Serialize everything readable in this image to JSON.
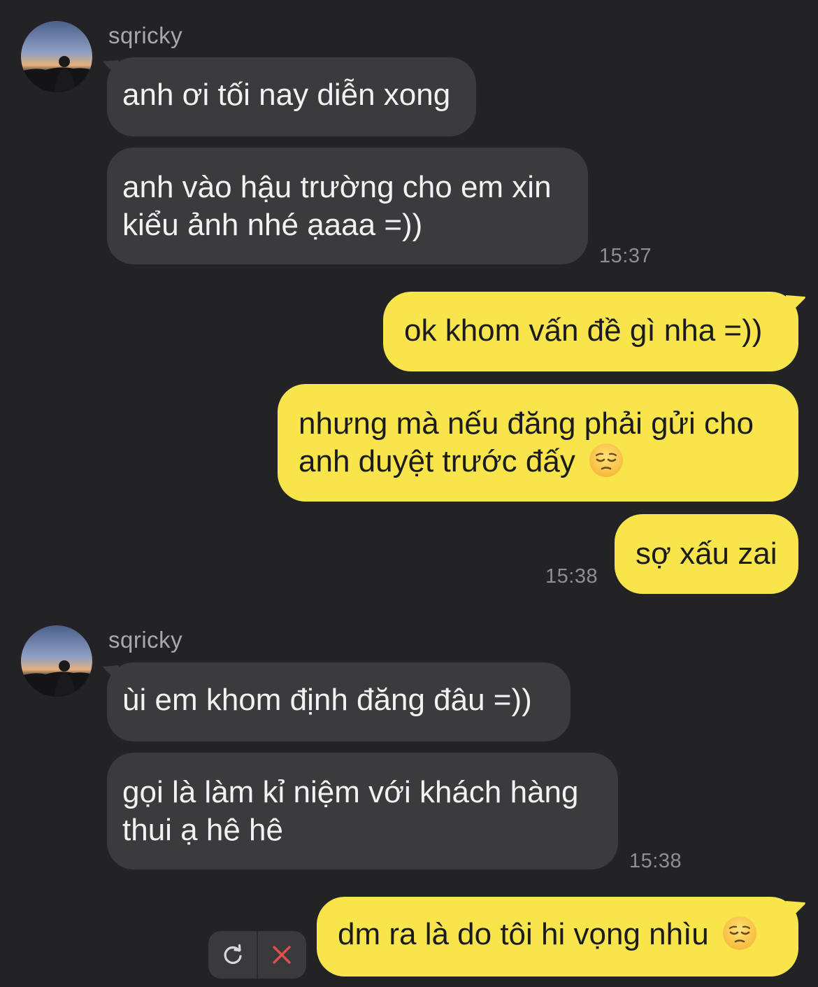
{
  "chat": {
    "contact_name": "sqricky",
    "colors": {
      "background": "#232325",
      "incoming_bubble": "#3b3b3e",
      "outgoing_bubble": "#f8e54c",
      "failed_icon": "#e0504a"
    },
    "groups": [
      {
        "direction": "incoming",
        "sender": "sqricky",
        "messages": [
          {
            "lines": [
              "anh ơi tối nay diễn xong"
            ]
          },
          {
            "lines": [
              "anh vào hậu trường cho em xin",
              "kiểu ảnh nhé ạaaa =))"
            ]
          }
        ],
        "time": "15:37"
      },
      {
        "direction": "outgoing",
        "messages": [
          {
            "lines": [
              "ok khom vấn đề gì nha =))"
            ]
          },
          {
            "lines": [
              "nhưng mà nếu đăng phải gửi cho",
              "anh duyệt trước đấy"
            ],
            "emoji": "pensive-face"
          },
          {
            "lines": [
              "sợ xấu zai"
            ]
          }
        ],
        "time": "15:38"
      },
      {
        "direction": "incoming",
        "sender": "sqricky",
        "messages": [
          {
            "lines": [
              "ùi em khom định đăng đâu =))"
            ]
          },
          {
            "lines": [
              "gọi là làm kỉ niệm với khách hàng",
              "thui ạ hê hê"
            ]
          }
        ],
        "time": "15:38"
      },
      {
        "direction": "outgoing",
        "status": "failed",
        "messages": [
          {
            "lines": [
              "dm ra là do tôi hi vọng nhìu"
            ],
            "emoji": "pensive-face"
          }
        ],
        "actions": {
          "retry_icon": "retry-icon",
          "cancel_icon": "cancel-x-icon"
        }
      }
    ]
  }
}
